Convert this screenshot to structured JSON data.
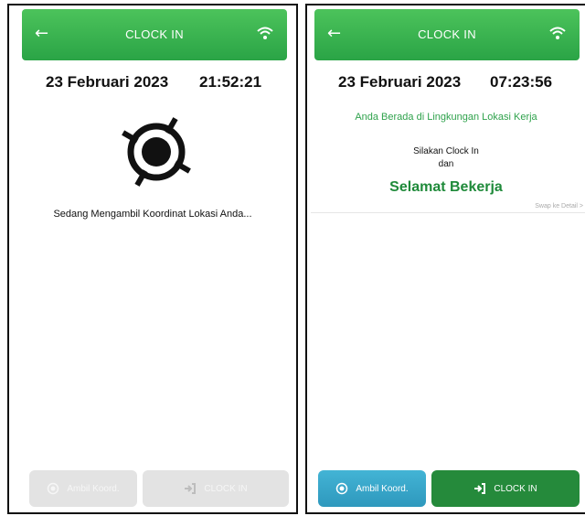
{
  "left": {
    "header": {
      "back_icon": "←",
      "title": "CLOCK IN",
      "wifi_icon": "wifi-icon"
    },
    "date": "23 Februari 2023",
    "time": "21:52:21",
    "status_text": "Sedang Mengambil Koordinat Lokasi Anda...",
    "buttons": {
      "ambil_label": "Ambil Koord.",
      "clockin_label": "CLOCK IN"
    }
  },
  "right": {
    "header": {
      "back_icon": "←",
      "title": "CLOCK IN",
      "wifi_icon": "wifi-icon"
    },
    "date": "23 Februari 2023",
    "time": "07:23:56",
    "location_status": "Anda Berada di Lingkungan Lokasi Kerja",
    "instruction_line1": "Silakan Clock In",
    "instruction_line2": "dan",
    "greeting": "Selamat Bekerja",
    "swap_link": "Swap ke Detail >",
    "buttons": {
      "ambil_label": "Ambil Koord.",
      "clockin_label": "CLOCK IN"
    }
  },
  "colors": {
    "header_green": "#3bb552",
    "clockin_green": "#258a3b",
    "ambil_blue": "#38a8cb",
    "disabled_gray": "#e3e3e3"
  }
}
